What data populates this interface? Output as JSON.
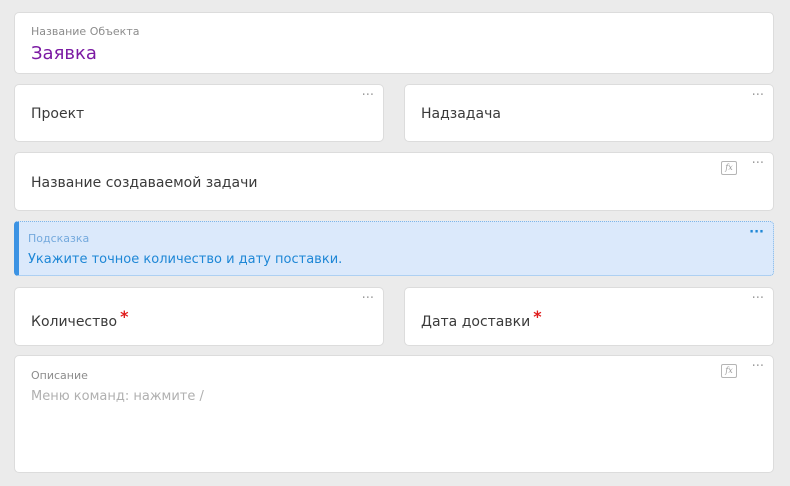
{
  "object_name": {
    "label": "Название Объекта",
    "value": "Заявка"
  },
  "fields": {
    "project": "Проект",
    "parent_task": "Надзадача",
    "task_name": "Название создаваемой задачи",
    "quantity": "Количество",
    "delivery_date": "Дата доставки"
  },
  "hint": {
    "label": "Подсказка",
    "text": "Укажите точное количество и дату поставки."
  },
  "description": {
    "label": "Описание",
    "placeholder": "Меню команд: нажмите /"
  },
  "controls": {
    "more": "···",
    "fx": "fx",
    "required_mark": "*"
  },
  "colors": {
    "accent_purple": "#7b1aa3",
    "hint_blue": "#1e87d6",
    "required_red": "#e01c1c"
  }
}
